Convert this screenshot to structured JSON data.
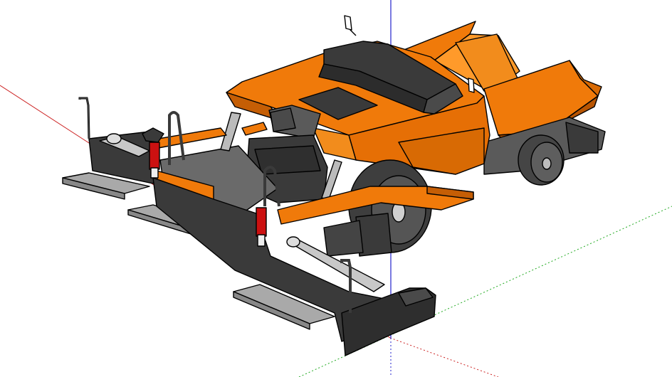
{
  "app": {
    "type": "3d-modeling-viewport",
    "view": "perspective"
  },
  "colors": {
    "background": "#ffffff",
    "body_orange": "#f07a0a",
    "body_orange_dark": "#c55e05",
    "body_orange_light": "#ff9a2a",
    "dark_gray": "#3a3a3a",
    "mid_gray": "#5a5a5a",
    "light_gray": "#b4b4b4",
    "screed_plate": "#a9a9a9",
    "axis_red": "#cc2222",
    "axis_green": "#22aa22",
    "axis_blue": "#2222cc",
    "reflector_red": "#cc1111"
  },
  "axes": {
    "red": {
      "name": "red-axis",
      "dashed": false
    },
    "green": {
      "name": "green-axis",
      "dashed": true
    },
    "blue": {
      "name": "blue-axis",
      "dashed": false
    }
  },
  "model": {
    "subject": "asphalt-paver",
    "parts": [
      "hopper",
      "engine-hood",
      "operator-platform",
      "screed",
      "rear-wheels",
      "auger-rods",
      "tail-lights",
      "handrails"
    ]
  }
}
